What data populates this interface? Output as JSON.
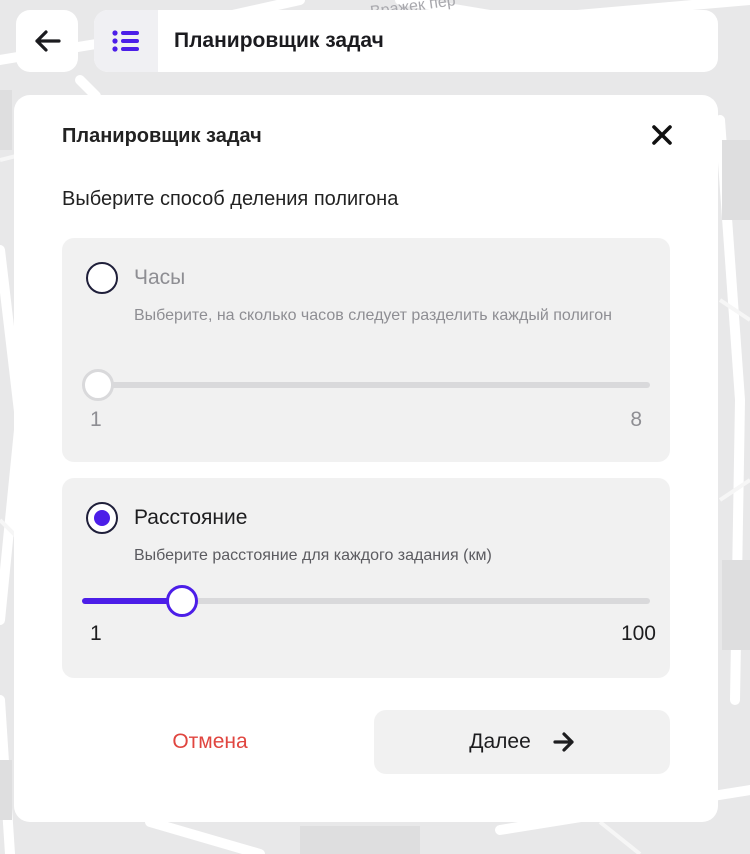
{
  "map": {
    "street_label": "Вражек пер"
  },
  "header": {
    "back_icon": "arrow-left-icon",
    "menu_icon": "list-icon",
    "title": "Планировщик задач"
  },
  "modal": {
    "title": "Планировщик задач",
    "close_icon": "close-icon",
    "subtitle": "Выберите способ деления полигона",
    "options": [
      {
        "label": "Часы",
        "description": "Выберите, на сколько часов следует разделить каждый полигон",
        "selected": false,
        "min": "1",
        "max": "8",
        "value": 1
      },
      {
        "label": "Расстояние",
        "description": "Выберите расстояние для каждого задания (км)",
        "selected": true,
        "min": "1",
        "max": "100",
        "value": 12
      }
    ],
    "cancel_label": "Отмена",
    "next_label": "Далее",
    "next_icon": "arrow-right-icon"
  },
  "colors": {
    "accent": "#4c1ee8",
    "danger": "#e0453f",
    "card": "#f1f1f1"
  }
}
